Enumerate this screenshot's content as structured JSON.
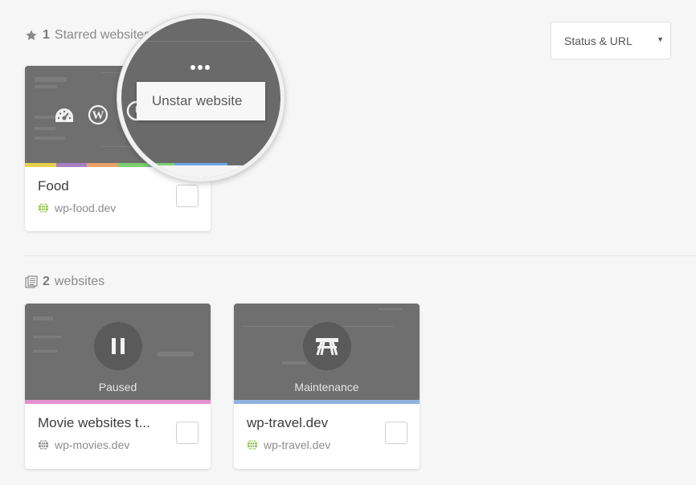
{
  "starred_section": {
    "count": "1",
    "label": "Starred websites",
    "icon": "star-icon"
  },
  "all_section": {
    "count": "2",
    "label": "websites",
    "icon": "documents-icon"
  },
  "sort": {
    "selected": "Status & URL"
  },
  "starred_menu": {
    "item": "Unstar website"
  },
  "cards": [
    {
      "title": "Food",
      "url": "wp-food.dev",
      "url_icon_color": "#8bc34a",
      "bar_colors": [
        "#e7d04a",
        "#a97fc4",
        "#e9a26a",
        "#7ccf6e",
        "#6aa7e3",
        "#5a8fd6"
      ]
    },
    {
      "title": "Movie websites t...",
      "url": "wp-movies.dev",
      "url_icon_color": "#888888",
      "status": "Paused",
      "status_icon": "pause-icon",
      "bar_colors": [
        "#e58fd0"
      ]
    },
    {
      "title": "wp-travel.dev",
      "url": "wp-travel.dev",
      "url_icon_color": "#8bc34a",
      "status": "Maintenance",
      "status_icon": "picnic-table-icon",
      "bar_colors": [
        "#8fb3e0"
      ]
    }
  ]
}
